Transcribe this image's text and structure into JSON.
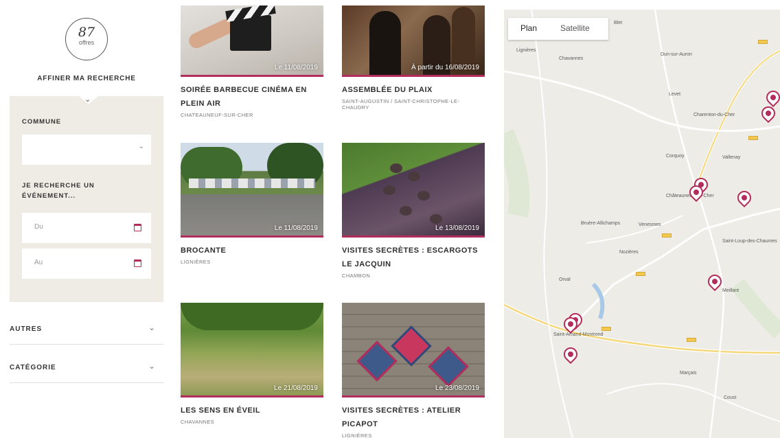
{
  "sidebar": {
    "count": "87",
    "count_label": "offres",
    "refine_title": "AFFINER MA RECHERCHE",
    "commune_label": "COMMUNE",
    "commune_value": "",
    "event_label": "JE RECHERCHE UN ÉVÉNEMENT...",
    "from_placeholder": "Du",
    "to_placeholder": "Au",
    "accordions": [
      {
        "label": "AUTRES"
      },
      {
        "label": "CATÉGORIE"
      }
    ]
  },
  "events": [
    {
      "title": "SOIRÉE BARBECUE CINÉMA EN PLEIN AIR",
      "place": "CHATEAUNEUF-SUR-CHER",
      "date": "Le 11/08/2019",
      "icon": "clapperboard"
    },
    {
      "title": "ASSEMBLÉE DU PLAIX",
      "place": "SAINT-AUGUSTIN / SAINT-CHRISTOPHE-LE-CHAUDRY",
      "date": "À partir du 16/08/2019",
      "icon": "musicians"
    },
    {
      "title": "BROCANTE",
      "place": "LIGNIÈRES",
      "date": "Le 11/08/2019",
      "icon": "market"
    },
    {
      "title": "VISITES SECRÈTES : ESCARGOTS LE JACQUIN",
      "place": "CHAMBON",
      "date": "Le 13/08/2019",
      "icon": "snails"
    },
    {
      "title": "LES SENS EN ÉVEIL",
      "place": "CHAVANNES",
      "date": "Le 21/08/2019",
      "icon": "meadow"
    },
    {
      "title": "VISITES SECRÈTES : ATELIER PICAPOT",
      "place": "LIGNIÈRES",
      "date": "Le 23/08/2019",
      "icon": "hearts"
    }
  ],
  "map": {
    "plan_label": "Plan",
    "satellite_label": "Satellite",
    "labels": [
      "Blet",
      "Dun-sur-Auron",
      "Lignières",
      "Châteauneuf-sur-Cher",
      "Saint-Amand-Montrond",
      "Levet",
      "Chavannes",
      "Venesmes",
      "Charenton-du-Cher",
      "Meillant",
      "Bruère-Allichamps",
      "Corquoy",
      "Vallenay",
      "Orval",
      "Saint-Loup-des-Chaumes",
      "Nozières",
      "Marçais",
      "Coust"
    ],
    "pin_color": "#b22d5b"
  },
  "colors": {
    "accent": "#b22d5b",
    "filter_bg": "#efebe5"
  }
}
